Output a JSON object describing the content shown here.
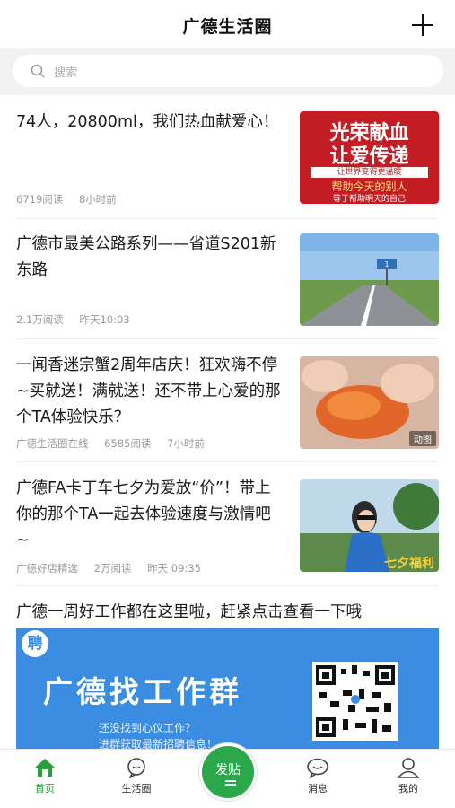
{
  "header": {
    "title": "广德生活圈"
  },
  "search": {
    "placeholder": "搜索"
  },
  "articles": [
    {
      "title": "74人，20800ml，我们热血献爱心！",
      "views": "6719阅读",
      "time": "8小时前",
      "thumb": {
        "line1": "光荣献血",
        "line2": "让爱传递",
        "line3": "让世界变得更温暖",
        "line4": "帮助今天的别人",
        "line5": "等于帮助明天的自己"
      }
    },
    {
      "title": "广德市最美公路系列——省道S201新东路",
      "views": "2.1万阅读",
      "time": "昨天10:03",
      "road_sign": "1"
    },
    {
      "title": "一闻香迷宗蟹2周年店庆！狂欢嗨不停~买就送！满就送！还不带上心爱的那个TA体验快乐？",
      "source": "广德生活圈在线",
      "views": "6585阅读",
      "time": "7小时前",
      "badge": "动图"
    },
    {
      "title": "广德FA卡丁车七夕为爱放“价”！带上你的那个TA一起去体验速度与激情吧~",
      "source": "广德好店精选",
      "views": "2万阅读",
      "time": "昨天 09:35",
      "thumb_caption": "七夕福利"
    }
  ],
  "banner": {
    "title": "广德一周好工作都在这里啦，赶紧点击查看一下哦",
    "pin": "聘",
    "headline": "广德找工作群",
    "sub1": "还没找到心仪工作？",
    "sub2": "进群获取最新招聘信息！"
  },
  "tabbar": {
    "home": "首页",
    "circle": "生活圈",
    "post": "发贴",
    "messages": "消息",
    "me": "我的"
  },
  "colors": {
    "accent": "#2aa84a",
    "banner": "#3b8de2"
  }
}
